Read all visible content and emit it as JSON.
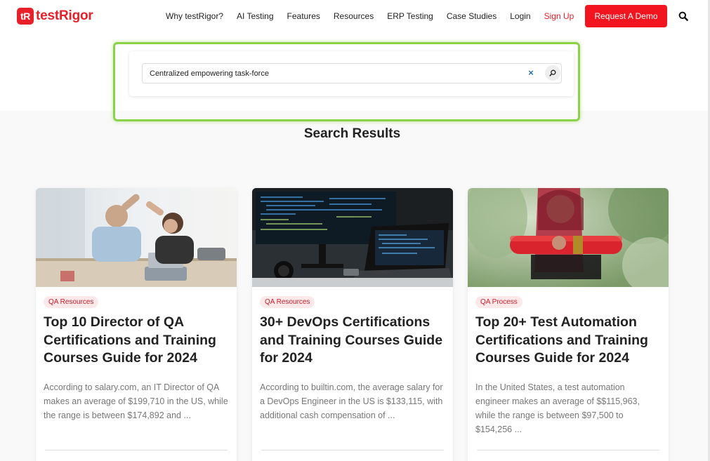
{
  "header": {
    "logo_mark": "tR",
    "logo_text": "testRigor",
    "nav": [
      {
        "label": "Why testRigor?"
      },
      {
        "label": "AI Testing"
      },
      {
        "label": "Features"
      },
      {
        "label": "Resources"
      },
      {
        "label": "ERP Testing"
      },
      {
        "label": "Case Studies"
      },
      {
        "label": "Login"
      },
      {
        "label": "Sign Up"
      }
    ],
    "demo_label": "Request A Demo",
    "search_icon": "search-icon",
    "brand_color": "#e8202a"
  },
  "search": {
    "value": "Centralized empowering task-force",
    "clear_label": "×",
    "clear_icon": "close-icon",
    "submit_icon": "search-icon"
  },
  "results": {
    "heading": "Search Results",
    "cards": [
      {
        "tag": "QA Resources",
        "title": "Top 10 Director of QA Certifications and Training Courses Guide for 2024",
        "excerpt": "According to salary.com, an IT Director of QA makes an average of $199,710 in the US, while the range is between $174,892 and ..."
      },
      {
        "tag": "QA Resources",
        "title": "30+ DevOps Certifications and Training Courses Guide for 2024",
        "excerpt": "According to builtin.com, the average salary for a DevOps Engineer in the US is $133,115, with additional cash compensation of ..."
      },
      {
        "tag": "QA Process",
        "title": "Top 20+ Test Automation Certifications and Training Courses Guide for 2024",
        "excerpt": "In the United States, a test automation engineer makes an average of $$115,963, while the range is between $97,500 to $154,256 ..."
      }
    ]
  }
}
